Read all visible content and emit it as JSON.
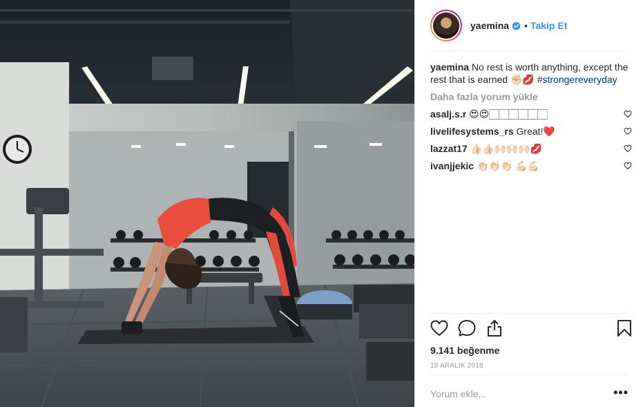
{
  "post": {
    "author": {
      "username": "yaemina",
      "verified": true,
      "follow_label": "Takip Et",
      "separator": "•"
    },
    "caption": {
      "username": "yaemina",
      "text": "No rest is worth anything, except the rest that is earned ✊🏻💋",
      "hashtag": "#strongereveryday"
    },
    "load_more_label": "Daha fazla yorum yükle",
    "comments": [
      {
        "username": "asalj.s.r",
        "text": "😍😍🏻🏻🏻🏻🏻🏻"
      },
      {
        "username": "livelifesystems_rs",
        "text": "Great!❤️"
      },
      {
        "username": "lazzat17",
        "text": "👍🏻👍🏻🙌🏻🙌🏻🙌🏻💋"
      },
      {
        "username": "ivanjjekic",
        "text": "👏🏻👏🏻👏🏻 💪🏻💪🏻"
      }
    ],
    "likes_label": "9.141 beğenme",
    "date": "18 ARALIK 2018",
    "comment_placeholder": "Yorum ekle...",
    "more_label": "•••",
    "icons": {
      "like": "heart-outline-icon",
      "comment": "speech-bubble-icon",
      "share": "share-upload-icon",
      "save": "bookmark-icon",
      "comment_like": "small-heart-icon",
      "verified": "verified-badge-icon"
    },
    "colors": {
      "link_blue": "#3897f0",
      "hashtag": "#003569",
      "muted_gray": "#999999",
      "text": "#262626",
      "verified_blue": "#3897f0"
    }
  }
}
